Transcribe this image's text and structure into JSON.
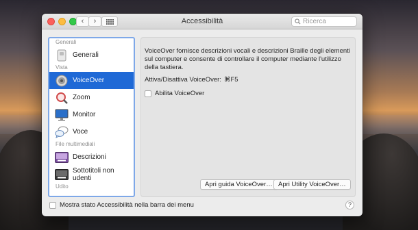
{
  "window": {
    "title": "Accessibilità"
  },
  "search": {
    "placeholder": "Ricerca"
  },
  "sidebar": {
    "sections": [
      {
        "label": "Generali",
        "items": [
          {
            "label": "Generali",
            "icon": "general-icon"
          }
        ]
      },
      {
        "label": "Vista",
        "items": [
          {
            "label": "VoiceOver",
            "icon": "voiceover-icon",
            "selected": true
          },
          {
            "label": "Zoom",
            "icon": "zoom-icon"
          },
          {
            "label": "Monitor",
            "icon": "monitor-icon"
          },
          {
            "label": "Voce",
            "icon": "speech-bubble-icon"
          }
        ]
      },
      {
        "label": "File multimediali",
        "items": [
          {
            "label": "Descrizioni",
            "icon": "descriptions-icon"
          },
          {
            "label": "Sottotitoli non udenti",
            "icon": "captions-icon"
          }
        ]
      },
      {
        "label": "Udito",
        "items": []
      }
    ]
  },
  "pane": {
    "description": "VoiceOver fornisce descrizioni vocali e descrizioni Braille degli elementi sul computer e consente di controllare il computer mediante l'utilizzo della tastiera.",
    "shortcut_label": "Attiva/Disattiva VoiceOver:",
    "shortcut_key": "⌘F5",
    "enable_label": "Abilita VoiceOver",
    "guide_button": "Apri guida VoiceOver…",
    "utility_button": "Apri Utility VoiceOver…"
  },
  "footer": {
    "menu_status_label": "Mostra stato Accessibilità nella barra dei menu",
    "help": "?"
  },
  "colors": {
    "selection": "#1f69d6",
    "focus_ring": "#7ea8e8"
  }
}
